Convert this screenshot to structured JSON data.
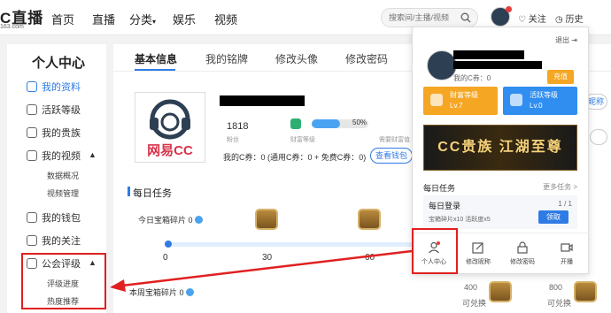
{
  "brand": {
    "logo_text": "C直播",
    "logo_sub": "163.com"
  },
  "nav": {
    "items": [
      "首页",
      "直播",
      "分类",
      "娱乐",
      "视频"
    ]
  },
  "search": {
    "placeholder": "搜索间/主播/视频"
  },
  "top_right": {
    "follow": "关注",
    "history": "历史"
  },
  "sidebar": {
    "title": "个人中心",
    "items": [
      "我的资料",
      "活跃等级",
      "我的贵族",
      "我的视频",
      "我的钱包",
      "我的关注",
      "公会评级"
    ],
    "video_sub": [
      "数据概况",
      "视频管理"
    ],
    "guild_sub": [
      "评级进度",
      "热度推荐"
    ],
    "active": "我的资料"
  },
  "tabs": [
    "基本信息",
    "我的铭牌",
    "修改头像",
    "修改密码"
  ],
  "profile": {
    "fans": "1818",
    "fans_label": "粉丝",
    "wealth_label": "财富等级",
    "wealth_progress": 0.5,
    "wealth_percent": "50%",
    "next_label": "需要财富值",
    "cc_line": "我的C券：0 (通用C券：0 + 免费C券：0)",
    "wallet_btn": "查看钱包",
    "logo_text": "网易CC"
  },
  "daily": {
    "title": "每日任务",
    "today_label": "今日宝箱碎片 0",
    "ticks": [
      "0",
      "30",
      "60"
    ],
    "week_label": "本周宝箱碎片 0",
    "rewards": [
      {
        "num": "400",
        "label": "可兑换"
      },
      {
        "num": "800",
        "label": "可兑换"
      }
    ]
  },
  "right_partial": {
    "btn1": "昵称",
    "btn2": ""
  },
  "dropdown": {
    "logout": "退出",
    "cc": "我的C券：0",
    "recharge": "充值",
    "wealth_card": {
      "title": "财富等级",
      "level": "Lv.7",
      "color": "#f5a623"
    },
    "active_card": {
      "title": "活跃等级",
      "level": "Lv.0",
      "color": "#2f8ef0"
    },
    "banner": "CC贵族 江湖至尊",
    "task_title": "每日任务",
    "task_more": "更多任务 >",
    "login_task": "每日登录",
    "login_count": "1 / 1",
    "login_reward": "宝箱碎片x10   活跃度x5",
    "claim": "领取",
    "buttons": [
      "个人中心",
      "修改昵称",
      "修改密码",
      "开播"
    ]
  },
  "colors": {
    "accent": "#2f7be5",
    "highlight": "#e02020"
  }
}
